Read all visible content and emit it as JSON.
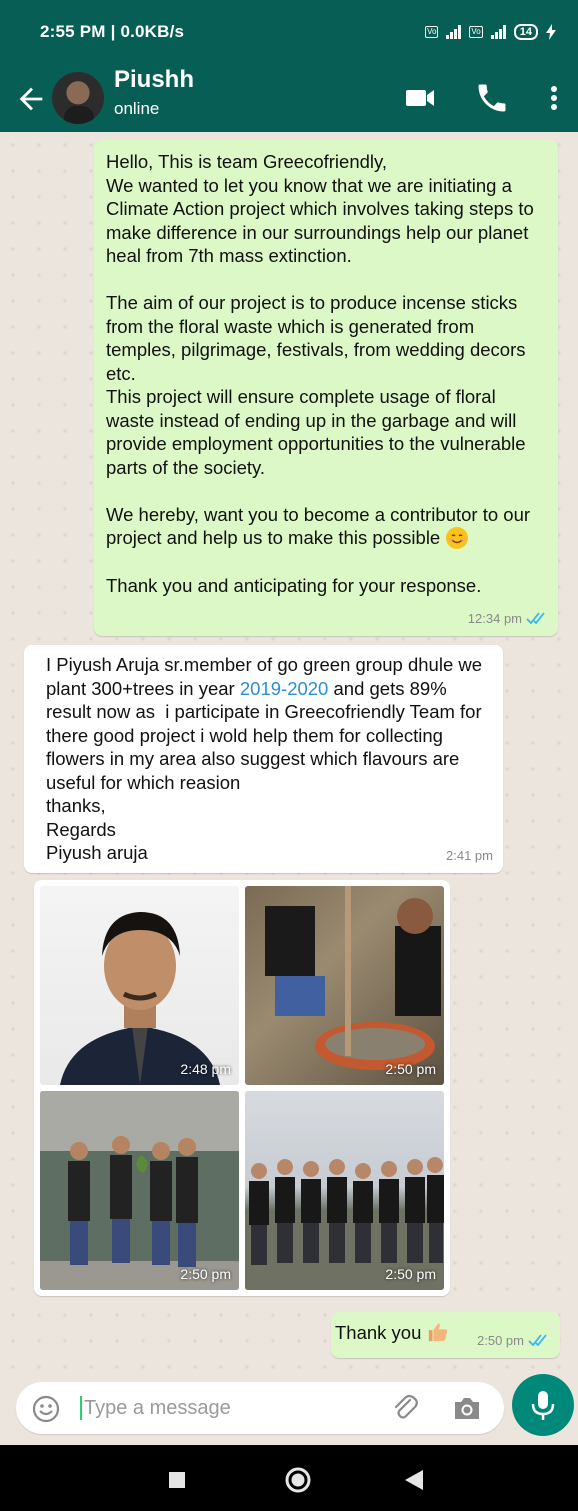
{
  "status_bar": {
    "time": "2:55 PM | 0.0KB/s",
    "battery": "14"
  },
  "header": {
    "contact_name": "Piushh",
    "contact_status": "online"
  },
  "messages": [
    {
      "direction": "outgoing",
      "text": "Hello, This is team Greecofriendly,\nWe wanted to let you know that we are initiating a Climate Action project which involves taking steps to make difference in our surroundings help our planet heal from 7th mass extinction.\n\nThe aim of our project is to produce incense sticks from the floral waste which is generated from temples, pilgrimage, festivals, from wedding decors etc.\nThis project will ensure complete usage of floral waste instead of ending up in the garbage and will provide employment opportunities to the vulnerable parts of the society.\n\nWe hereby, want you to become a contributor to our project and help us to make this possible",
      "text_end": "\n\nThank you and anticipating for your response.",
      "time": "12:34 pm"
    },
    {
      "direction": "incoming",
      "text_a": "I Piyush Aruja sr.member of go green group dhule we plant 300+trees in year ",
      "link": "2019-2020",
      "text_b": " and gets 89% result now as  i participate in Greecofriendly Team for there good project i wold help them for collecting flowers in my area also suggest which flavours are useful for which reasion\nthanks,\nRegards\nPiyush aruja",
      "time": "2:41 pm"
    },
    {
      "direction": "incoming",
      "type": "photo_album",
      "photos": [
        {
          "time": "2:48 pm"
        },
        {
          "time": "2:50 pm"
        },
        {
          "time": "2:50 pm"
        },
        {
          "time": "2:50 pm"
        }
      ]
    },
    {
      "direction": "outgoing",
      "text": "Thank you",
      "time": "2:50 pm"
    }
  ],
  "composer": {
    "placeholder": "Type a message"
  },
  "icons": {
    "back": "back-arrow-icon",
    "video": "video-call-icon",
    "call": "phone-icon",
    "menu": "more-vert-icon",
    "emoji": "emoji-icon",
    "attach": "paperclip-icon",
    "camera": "camera-icon",
    "mic": "mic-icon"
  },
  "colors": {
    "header": "#075e54",
    "outgoing_bubble": "#dcf8c6",
    "incoming_bubble": "#ffffff",
    "chat_bg": "#ece5dd",
    "read_ticks": "#34b7f1",
    "mic_button": "#00897b"
  }
}
